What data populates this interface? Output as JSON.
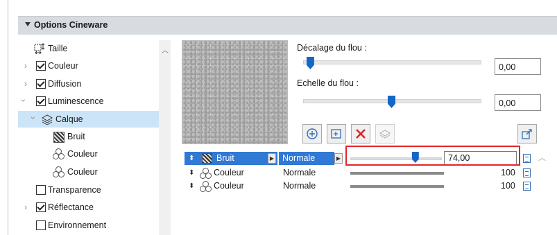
{
  "panel": {
    "title": "Options Cineware"
  },
  "tree": {
    "items": [
      {
        "label": "Taille",
        "checkbox": false
      },
      {
        "label": "Couleur",
        "checkbox": true,
        "checked": true
      },
      {
        "label": "Diffusion",
        "checkbox": true,
        "checked": true
      },
      {
        "label": "Luminescence",
        "checkbox": true,
        "checked": true,
        "expanded": true
      },
      {
        "label": "Calque",
        "selected": true,
        "expanded": true
      },
      {
        "label": "Bruit"
      },
      {
        "label": "Couleur"
      },
      {
        "label": "Couleur"
      },
      {
        "label": "Transparence",
        "checkbox": true,
        "checked": false
      },
      {
        "label": "Réflectance",
        "checkbox": true,
        "checked": true
      },
      {
        "label": "Environnement",
        "checkbox": true,
        "checked": false
      }
    ]
  },
  "blur_offset": {
    "label": "Décalage du flou :",
    "value": "0,00",
    "slider_fraction": 0.02
  },
  "blur_scale": {
    "label": "Echelle du flou :",
    "value": "0,00",
    "slider_fraction": 0.5
  },
  "toolbar": {
    "icons": [
      "add-shader-icon",
      "add-folder-icon",
      "delete-icon",
      "duplicate-icon",
      "export-icon"
    ]
  },
  "layers": [
    {
      "name": "Bruit",
      "mode": "Normale",
      "value": "74,00",
      "slider_fraction": 0.74,
      "selected": true
    },
    {
      "name": "Couleur",
      "mode": "Normale",
      "value": "100",
      "slider_fraction": 1.0
    },
    {
      "name": "Couleur",
      "mode": "Normale",
      "value": "100",
      "slider_fraction": 1.0
    }
  ],
  "colors": {
    "accent": "#1466c7",
    "selection": "#3079d4",
    "highlight": "#e0262b"
  }
}
